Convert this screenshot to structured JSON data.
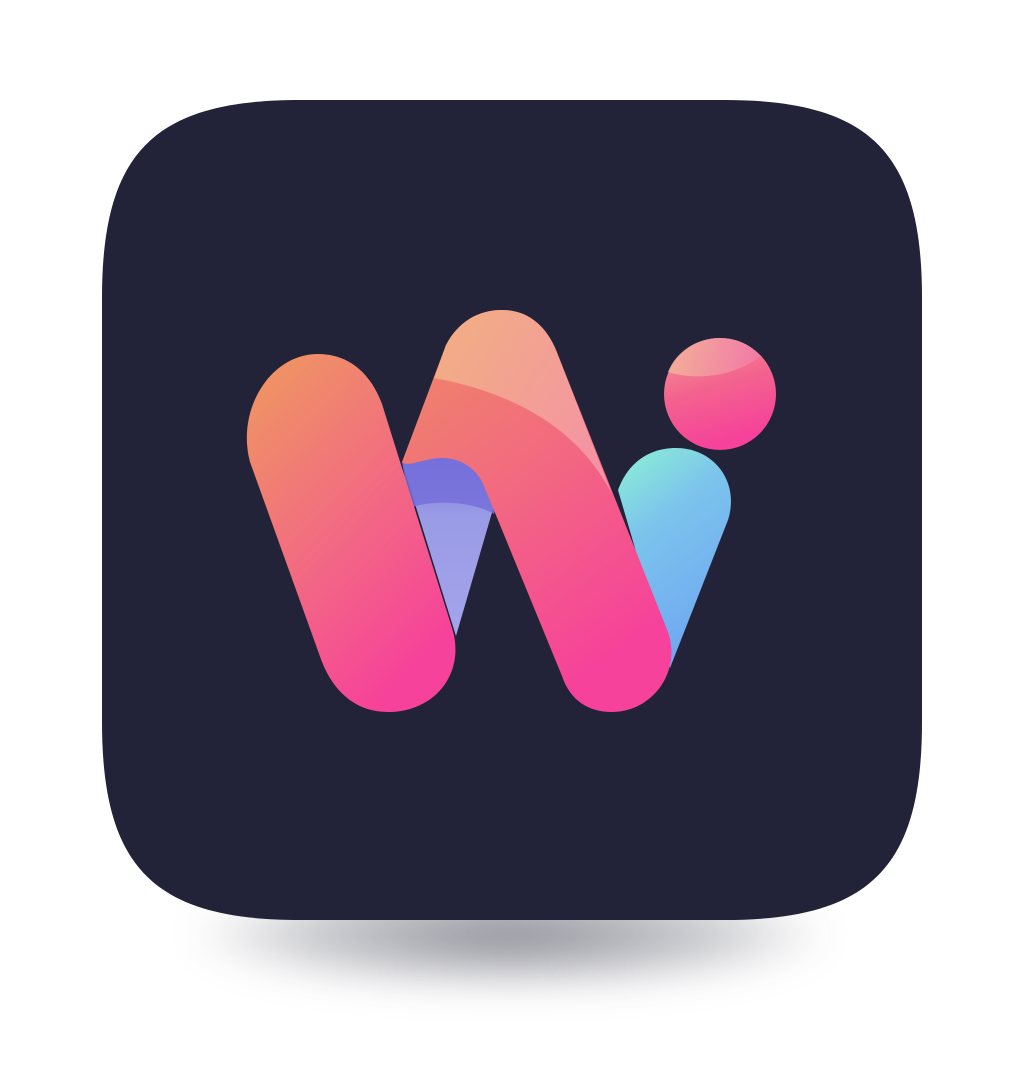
{
  "app_icon": {
    "name": "W app icon",
    "background_color": "#222339",
    "logo_letter": "W",
    "colors": {
      "orange": "#EE9A5E",
      "pink": "#F6429A",
      "peach": "#F2B483",
      "violet": "#6D66D6",
      "lavender": "#A3A4EA",
      "mint": "#8DF2D4",
      "sky_blue": "#6FA9F2"
    }
  }
}
